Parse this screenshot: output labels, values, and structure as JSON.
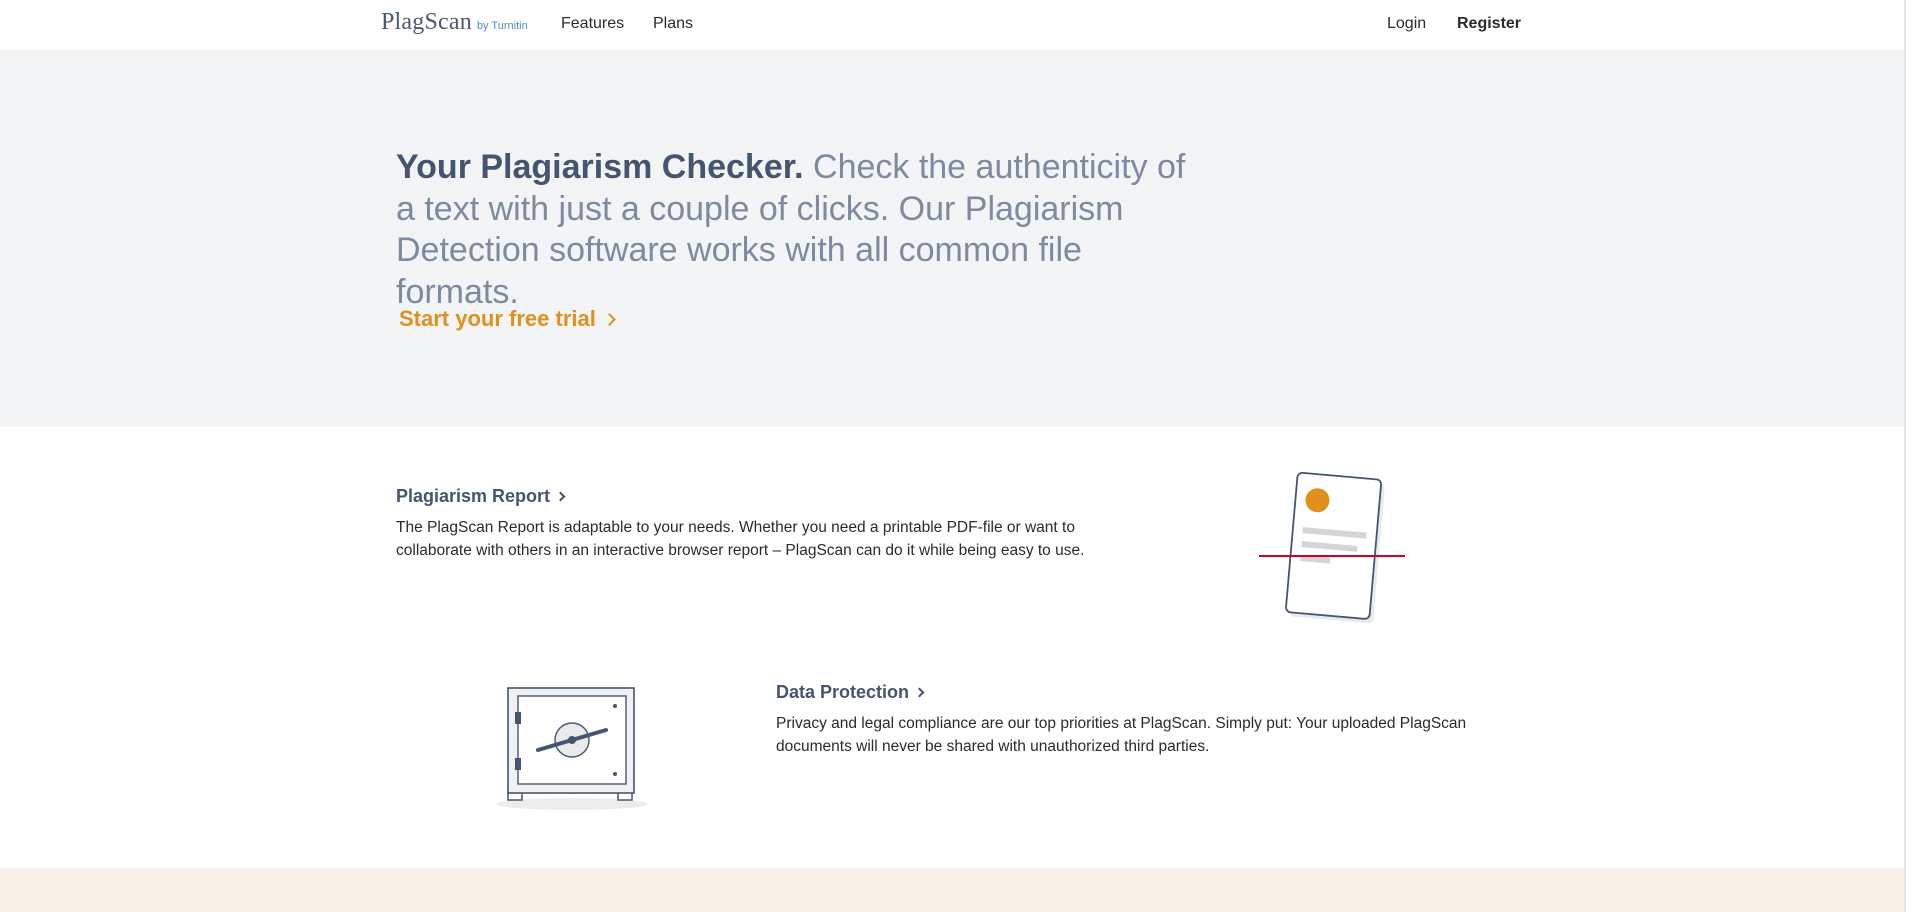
{
  "header": {
    "logo": {
      "word_start": "Plag",
      "word_s": "S",
      "word_end": "can",
      "by": "by Turnitin"
    },
    "nav": {
      "features": "Features",
      "plans": "Plans"
    },
    "auth": {
      "login": "Login",
      "register": "Register"
    }
  },
  "hero": {
    "headline_strong": "Your Plagiarism Checker.",
    "headline_rest": " Check the authenticity of a text with just a couple of clicks. Our Plagiarism Detection software works with all common file formats.",
    "cta": "Start your free trial"
  },
  "features": [
    {
      "title": "Plagiarism Report",
      "description": "The PlagScan Report is adaptable to your needs. Whether you need a printable PDF-file or want to collaborate with others in an interactive browser report – PlagScan can do it while being easy to use.",
      "icon": "document-scan-icon"
    },
    {
      "title": "Data Protection",
      "description": "Privacy and legal compliance are our top priorities at PlagScan. Simply put: Your uploaded PlagScan documents will never be shared with unauthorized third parties.",
      "icon": "safe-icon"
    }
  ],
  "colors": {
    "accent": "#e0901c",
    "heading": "#46556f",
    "hero_bg": "#f3f4f6",
    "scan_line": "#d0021b",
    "footer_bg": "#f7f1e8"
  }
}
